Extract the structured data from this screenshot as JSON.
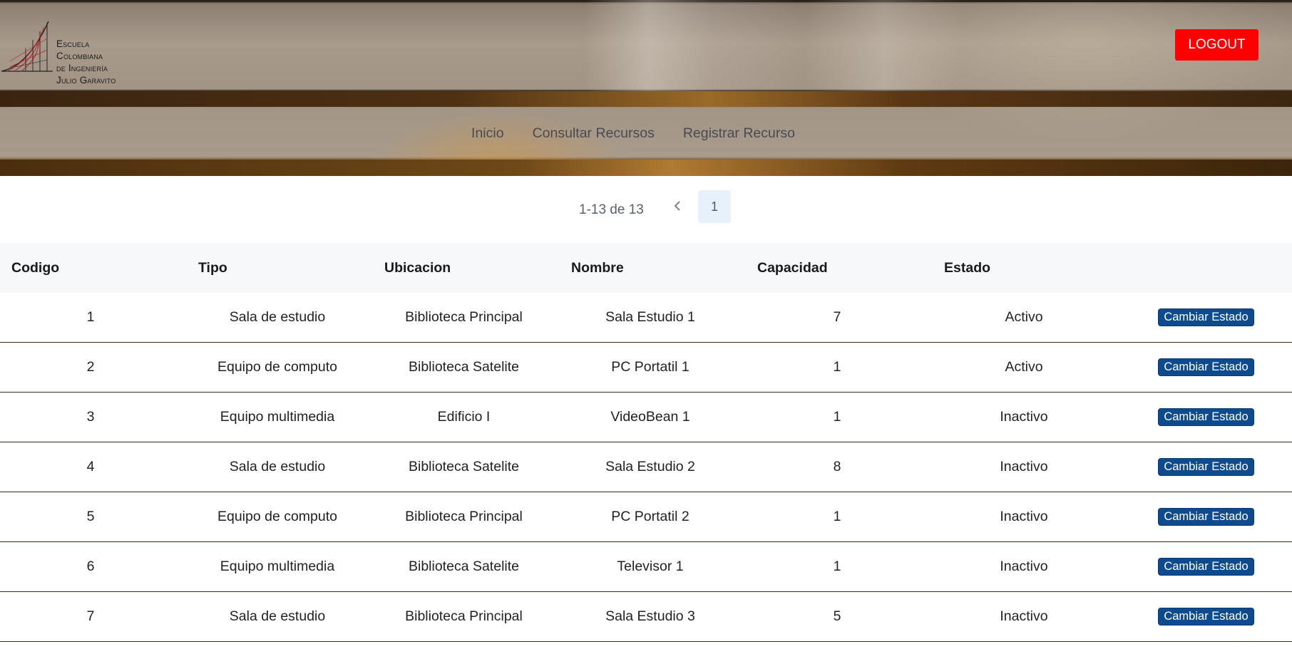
{
  "logo": {
    "lines": [
      "Escuela",
      "Colombiana",
      "de Ingeniería",
      "Julio Garavito"
    ]
  },
  "header": {
    "logout_label": "LOGOUT"
  },
  "nav": {
    "items": [
      {
        "label": "Inicio"
      },
      {
        "label": "Consultar Recursos"
      },
      {
        "label": "Registrar Recurso"
      }
    ]
  },
  "pagination": {
    "range": "1-13 de 13",
    "current_page": "1"
  },
  "table": {
    "columns": [
      "Codigo",
      "Tipo",
      "Ubicacion",
      "Nombre",
      "Capacidad",
      "Estado",
      ""
    ],
    "action_label": "Cambiar Estado",
    "rows": [
      {
        "codigo": "1",
        "tipo": "Sala de estudio",
        "ubicacion": "Biblioteca Principal",
        "nombre": "Sala Estudio 1",
        "capacidad": "7",
        "estado": "Activo"
      },
      {
        "codigo": "2",
        "tipo": "Equipo de computo",
        "ubicacion": "Biblioteca Satelite",
        "nombre": "PC Portatil 1",
        "capacidad": "1",
        "estado": "Activo"
      },
      {
        "codigo": "3",
        "tipo": "Equipo multimedia",
        "ubicacion": "Edificio I",
        "nombre": "VideoBean 1",
        "capacidad": "1",
        "estado": "Inactivo"
      },
      {
        "codigo": "4",
        "tipo": "Sala de estudio",
        "ubicacion": "Biblioteca Satelite",
        "nombre": "Sala Estudio 2",
        "capacidad": "8",
        "estado": "Inactivo"
      },
      {
        "codigo": "5",
        "tipo": "Equipo de computo",
        "ubicacion": "Biblioteca Principal",
        "nombre": "PC Portatil 2",
        "capacidad": "1",
        "estado": "Inactivo"
      },
      {
        "codigo": "6",
        "tipo": "Equipo multimedia",
        "ubicacion": "Biblioteca Satelite",
        "nombre": "Televisor 1",
        "capacidad": "1",
        "estado": "Inactivo"
      },
      {
        "codigo": "7",
        "tipo": "Sala de estudio",
        "ubicacion": "Biblioteca Principal",
        "nombre": "Sala Estudio 3",
        "capacidad": "5",
        "estado": "Inactivo"
      }
    ]
  },
  "colors": {
    "logout": "#ff0000",
    "state_button": "#0e4a8e",
    "page_active_bg": "#e6f1fb",
    "table_header_bg": "#f7f8fa"
  },
  "icons": {
    "prev": "chevron-left-icon",
    "logo": "university-logo"
  }
}
